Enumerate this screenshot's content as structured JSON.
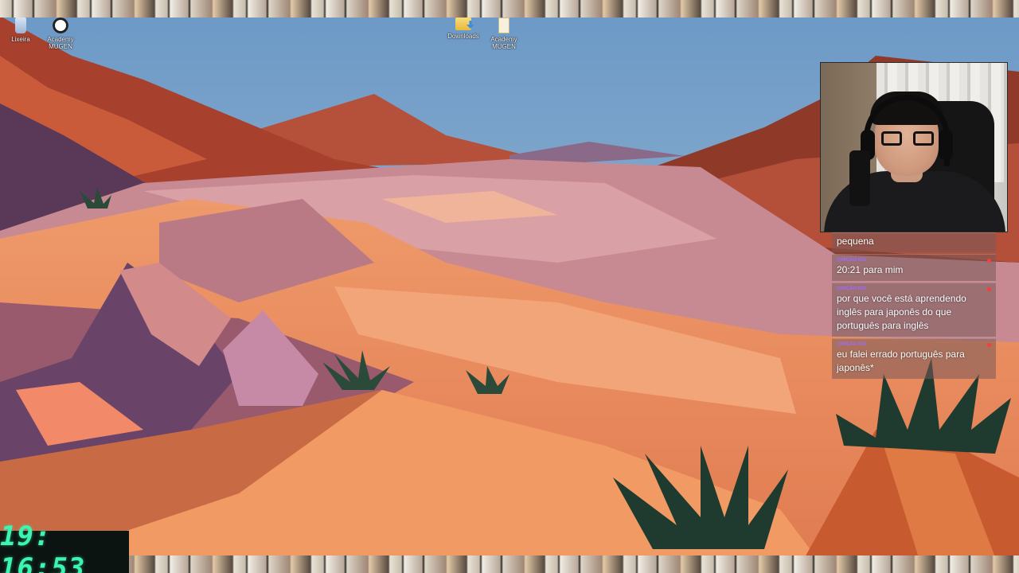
{
  "desktop": {
    "icons": [
      {
        "label": "Lixeira",
        "icon": "recycle-bin-icon"
      },
      {
        "label": "Academy MUGEN",
        "icon": "mugen-app-icon"
      },
      {
        "label": "Downloads",
        "icon": "downloads-folder-icon"
      },
      {
        "label": "Academy MUGEN",
        "icon": "mugen-file-icon"
      }
    ]
  },
  "chat": {
    "messages": [
      {
        "user": "",
        "text": "pequena"
      },
      {
        "user": "@NIÇÃO KSI",
        "text": "20:21 para mim"
      },
      {
        "user": "@NIÇÃO KSI",
        "text": "por que você está aprendendo inglês para japonês do que português para inglês"
      },
      {
        "user": "@NIÇÃO KSI",
        "text": "eu falei errado português para japonês*"
      }
    ]
  },
  "clock": {
    "time": "19: 16:53",
    "color": "#3cf5b0"
  }
}
